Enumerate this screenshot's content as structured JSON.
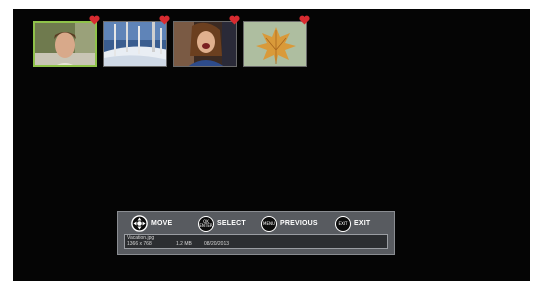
{
  "thumbnails": [
    {
      "name": "photo-young-man",
      "favorite": true,
      "selected": true
    },
    {
      "name": "photo-snowy-forest",
      "favorite": true,
      "selected": false
    },
    {
      "name": "photo-laughing-woman",
      "favorite": true,
      "selected": false
    },
    {
      "name": "photo-autumn-leaf",
      "favorite": true,
      "selected": false
    }
  ],
  "controls": {
    "move": {
      "icon": "dpad-icon",
      "label": "MOVE"
    },
    "select": {
      "icon_text": "OK ENTER",
      "label": "SELECT"
    },
    "previous": {
      "icon_text": "MENU",
      "label": "PREVIOUS"
    },
    "exit": {
      "icon_text": "EXIT",
      "label": "EXIT"
    }
  },
  "file_info": {
    "filename": "Vacation.jpg",
    "resolution": "1366 x 768",
    "size": "1.2 MB",
    "date": "08/20/2013"
  },
  "colors": {
    "selection_border": "#8fc24a",
    "heart": "#d92b30",
    "panel": "#585b60"
  }
}
